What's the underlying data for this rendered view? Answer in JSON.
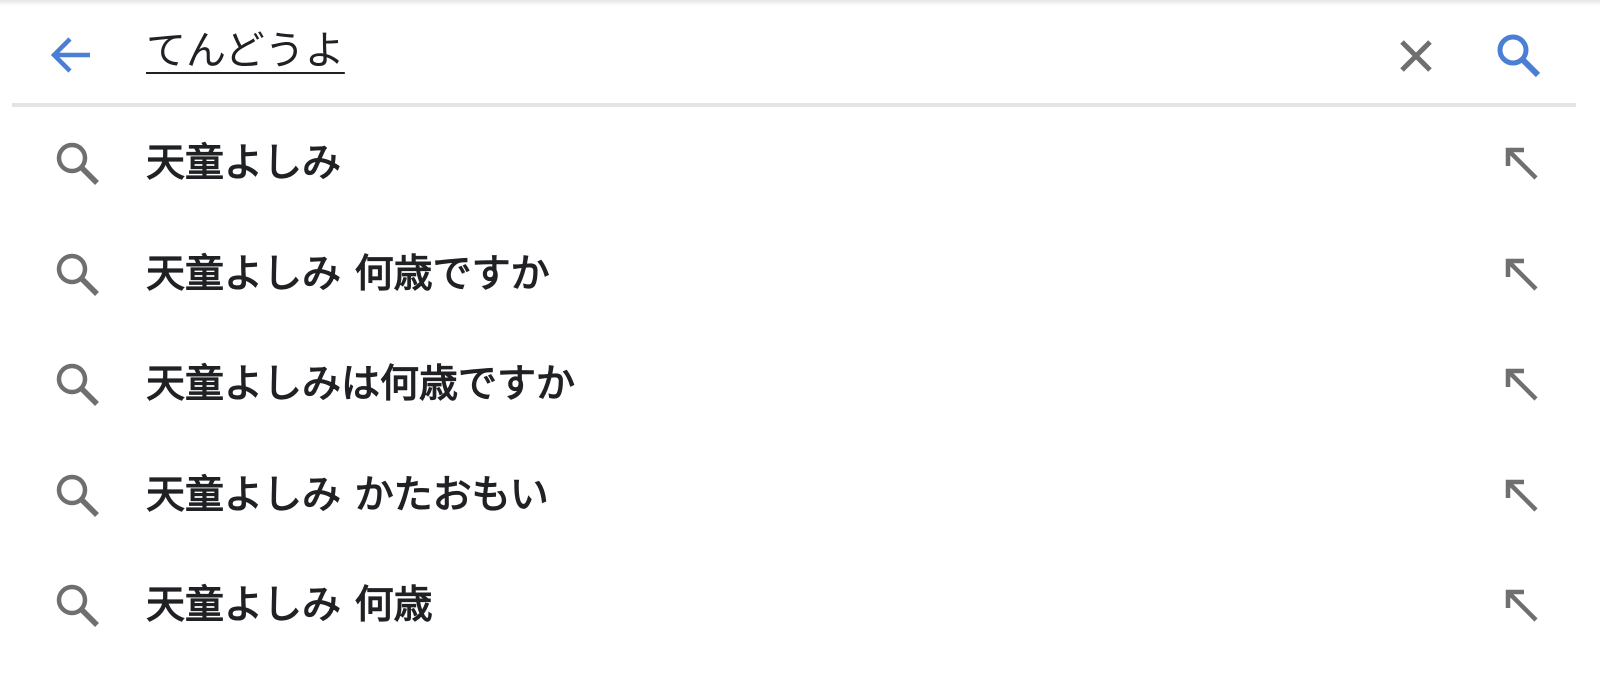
{
  "search": {
    "query": "てんどうよ",
    "back_icon": "arrow-back-icon",
    "clear_icon": "close-icon",
    "search_icon": "search-icon",
    "accent_color": "#4a7fd4"
  },
  "suggestions": [
    {
      "label": "天童よしみ"
    },
    {
      "label": "天童よしみ 何歳ですか"
    },
    {
      "label": "天童よしみは何歳ですか"
    },
    {
      "label": "天童よしみ かたおもい"
    },
    {
      "label": "天童よしみ 何歳"
    }
  ],
  "colors": {
    "icon_gray": "#6f6f6f",
    "text": "#202124",
    "divider": "#e4e4e4"
  }
}
